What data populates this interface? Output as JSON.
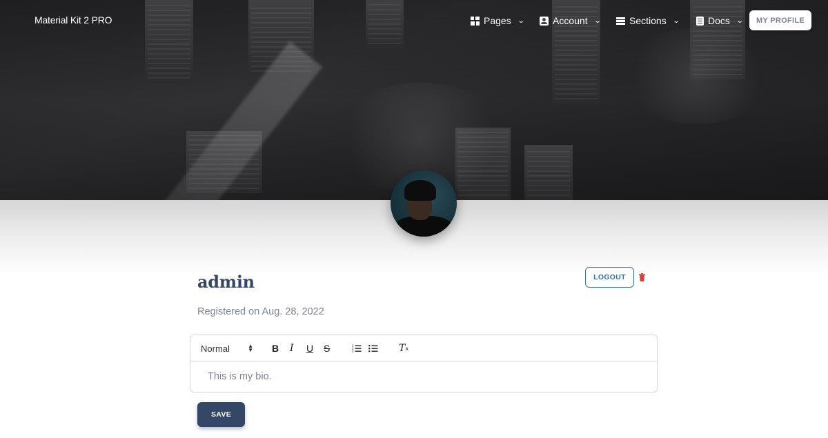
{
  "brand": "Material Kit 2 PRO",
  "nav": {
    "pages": "Pages",
    "account": "Account",
    "sections": "Sections",
    "docs": "Docs",
    "my_profile": "MY PROFILE"
  },
  "profile": {
    "username": "admin",
    "registered": "Registered on Aug. 28, 2022",
    "logout": "LOGOUT"
  },
  "editor": {
    "format_select": "Normal",
    "bio": "This is my bio."
  },
  "save": "SAVE",
  "colors": {
    "primary": "#344767",
    "muted": "#7b809a",
    "info": "#2f6fb0",
    "danger": "#e53935"
  },
  "icons": [
    "pages-icon",
    "account-icon",
    "sections-icon",
    "docs-icon",
    "chevron-down-icon",
    "trash-icon",
    "bold-icon",
    "italic-icon",
    "underline-icon",
    "strike-icon",
    "ordered-list-icon",
    "bullet-list-icon",
    "clear-format-icon"
  ]
}
